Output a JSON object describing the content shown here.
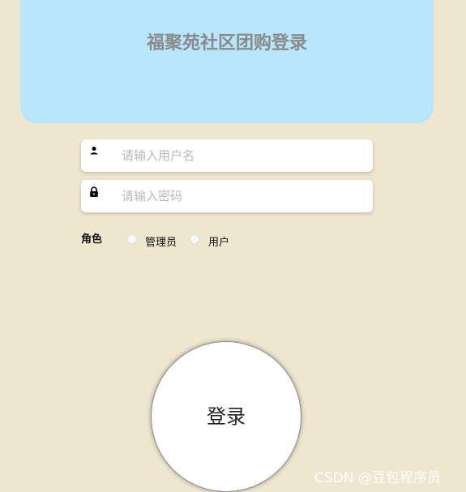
{
  "header": {
    "title": "福聚苑社区团购登录"
  },
  "form": {
    "username": {
      "value": "",
      "placeholder": "请输入用户名",
      "icon": "user-icon"
    },
    "password": {
      "value": "",
      "placeholder": "请输入密码",
      "icon": "lock-icon"
    },
    "role": {
      "label": "角色",
      "options": [
        {
          "label": "管理员",
          "selected": false
        },
        {
          "label": "用户",
          "selected": false
        }
      ]
    },
    "login_label": "登录"
  },
  "watermark": "CSDN @豆包程序员",
  "colors": {
    "background": "#efe6cf",
    "banner": "#b8e6fb",
    "title": "#8a8a8a"
  }
}
